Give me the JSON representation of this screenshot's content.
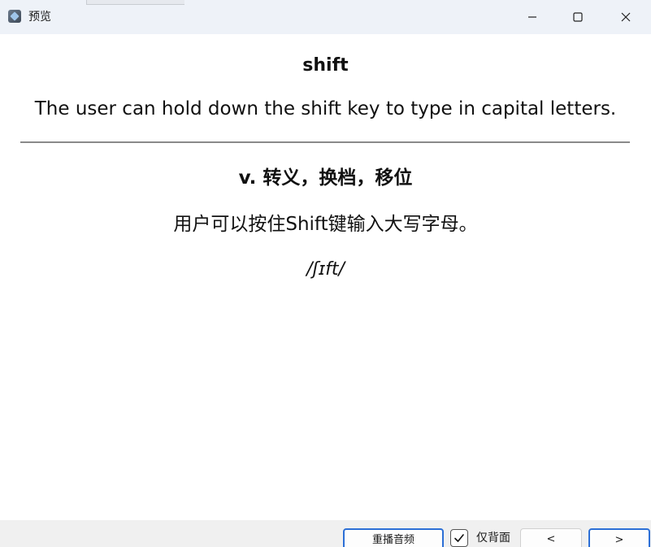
{
  "window": {
    "title": "预览"
  },
  "card": {
    "term": "shift",
    "example_en": "The user can hold down the shift key to type in capital letters.",
    "definition": "v. 转义，换档，移位",
    "example_zh": "用户可以按住Shift键输入大写字母。",
    "phonetic": "/ʃɪft/"
  },
  "footer": {
    "replay_label": "重播音频",
    "back_only_label": "仅背面",
    "back_only_checked": true,
    "prev_label": "<",
    "next_label": ">"
  },
  "icons": {
    "app": "app-icon",
    "minimize": "minimize-icon",
    "maximize": "maximize-icon",
    "close": "close-icon",
    "check": "checkmark-icon"
  },
  "colors": {
    "titlebar": "#eef2f8",
    "accent": "#2c6fd6",
    "footer": "#f0f0f0"
  }
}
